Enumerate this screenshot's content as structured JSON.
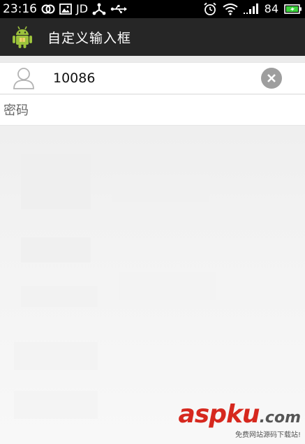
{
  "status_bar": {
    "time": "23:16",
    "left_icons": [
      "link-icon",
      "image-icon",
      "jd-icon",
      "share-icon",
      "usb-icon"
    ],
    "jd_label": "JD",
    "battery_level": "84",
    "right_icons": [
      "alarm-icon",
      "wifi-icon",
      "signal-icon",
      "battery-icon"
    ],
    "battery_color": "#3bd23b"
  },
  "action_bar": {
    "title": "自定义输入框",
    "app_icon": "android-icon",
    "background": "#262626",
    "accent": "#9cc23c"
  },
  "form": {
    "username": {
      "value": "10086",
      "icon": "user-icon",
      "clear_icon": "clear-icon"
    },
    "password": {
      "placeholder": "密码",
      "value": ""
    }
  },
  "watermark": {
    "brand_prefix": "asp",
    "brand_suffix": "ku",
    "domain": ".com",
    "subtitle": "免费网站源码下载站!",
    "color": "#d6281e"
  }
}
